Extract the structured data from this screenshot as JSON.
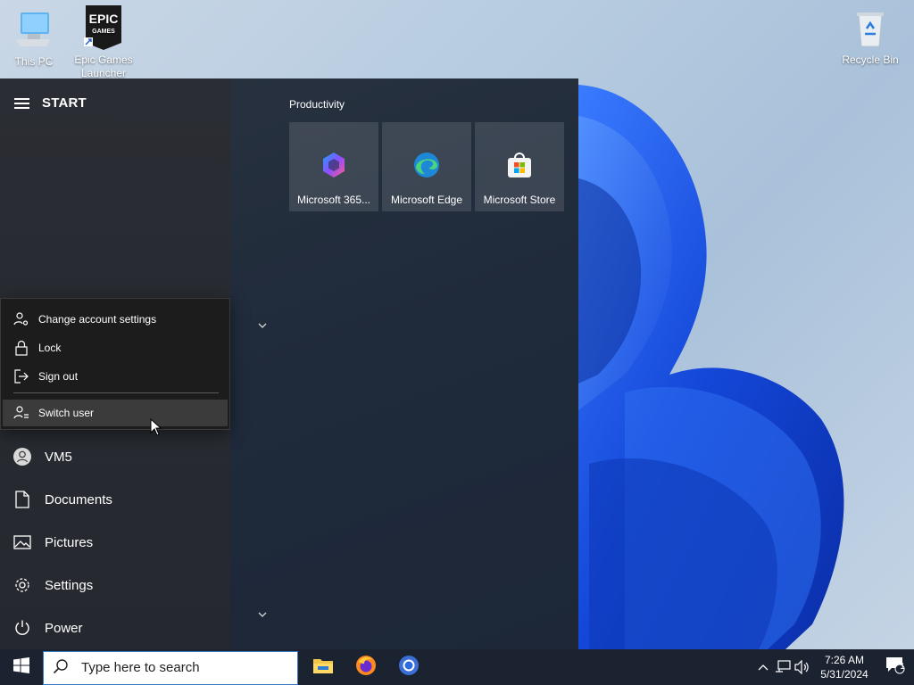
{
  "desktop": {
    "icons": [
      {
        "label": "This PC",
        "icon": "computer-icon"
      },
      {
        "label": "Epic Games Launcher",
        "icon": "epic-games-icon",
        "logo_text": "EPIC GAMES"
      },
      {
        "label": "Recycle Bin",
        "icon": "recycle-bin-icon"
      }
    ]
  },
  "start": {
    "title": "START",
    "account_menu": {
      "items": [
        {
          "label": "Change account settings",
          "icon": "account-settings-icon"
        },
        {
          "label": "Lock",
          "icon": "lock-icon"
        },
        {
          "label": "Sign out",
          "icon": "sign-out-icon"
        },
        {
          "label": "Switch user",
          "icon": "switch-user-icon",
          "hovered": true
        }
      ]
    },
    "rail": [
      {
        "label": "VM5",
        "icon": "user-avatar-icon"
      },
      {
        "label": "Documents",
        "icon": "document-icon"
      },
      {
        "label": "Pictures",
        "icon": "pictures-icon"
      },
      {
        "label": "Settings",
        "icon": "gear-icon"
      },
      {
        "label": "Power",
        "icon": "power-icon"
      }
    ],
    "group": {
      "title": "Productivity",
      "tiles": [
        {
          "label": "Microsoft 365...",
          "icon": "microsoft-365-icon"
        },
        {
          "label": "Microsoft Edge",
          "icon": "edge-icon"
        },
        {
          "label": "Microsoft Store",
          "icon": "store-icon"
        }
      ]
    }
  },
  "taskbar": {
    "search_placeholder": "Type here to search",
    "apps": [
      "file-explorer-icon",
      "firefox-icon",
      "chrome-icon"
    ],
    "clock": {
      "time": "7:26 AM",
      "date": "5/31/2024"
    },
    "notification_count": "1"
  },
  "colors": {
    "taskbar": "#1b2230",
    "accent": "#3b78c4",
    "bloom": "#1a4fd6"
  }
}
